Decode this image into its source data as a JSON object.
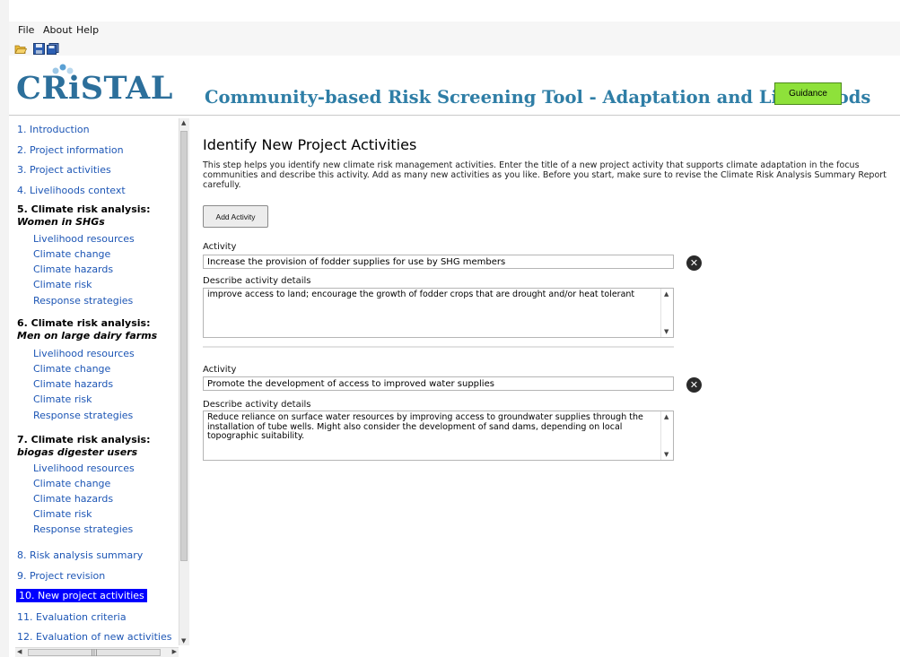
{
  "menu": [
    "File",
    "About",
    "Help"
  ],
  "toolbar": {
    "icons": [
      "folder-open-icon",
      "save-icon",
      "save-all-icon"
    ]
  },
  "logo": {
    "text": "CRiSTAL"
  },
  "header": {
    "title": "Community-based Risk Screening Tool - Adaptation and Livelihoods",
    "guidance_label": "Guidance"
  },
  "sidebar": {
    "items": [
      {
        "label": "1. Introduction"
      },
      {
        "label": "2. Project information"
      },
      {
        "label": "3. Project activities"
      },
      {
        "label": "4. Livelihoods context"
      }
    ],
    "groups": [
      {
        "title": "5. Climate risk analysis:",
        "subtitle": "Women in SHGs",
        "sub": [
          "Livelihood resources",
          "Climate change",
          "Climate hazards",
          "Climate risk",
          "Response strategies"
        ]
      },
      {
        "title": "6. Climate risk analysis:",
        "subtitle": "Men on large dairy farms",
        "sub": [
          "Livelihood resources",
          "Climate change",
          "Climate hazards",
          "Climate risk",
          "Response strategies"
        ]
      },
      {
        "title": "7. Climate risk analysis:",
        "subtitle": "biogas digester users",
        "sub": [
          "Livelihood resources",
          "Climate change",
          "Climate hazards",
          "Climate risk",
          "Response strategies"
        ]
      }
    ],
    "bottom_items": [
      {
        "label": "8. Risk analysis summary"
      },
      {
        "label": "9. Project revision"
      },
      {
        "label": "10. New project activities"
      },
      {
        "label": "11. Evaluation criteria"
      },
      {
        "label": "12. Evaluation of new activities"
      }
    ]
  },
  "main": {
    "title": "Identify New Project Activities",
    "description": "This step helps you identify new climate risk management activities. Enter the title of a new project activity that supports climate adaptation in the focus communities and describe this activity. Add as many new activities as you like. Before you start, make sure to revise the Climate Risk Analysis Summary Report carefully.",
    "add_button": "Add Activity",
    "activity_label": "Activity",
    "details_label": "Describe activity details",
    "activities": [
      {
        "title": "Increase the provision of fodder supplies for use by SHG members",
        "details": "improve access to land; encourage the growth of fodder crops that are drought and/or heat tolerant"
      },
      {
        "title": "Promote the development of access to improved water supplies",
        "details": "Reduce reliance on surface water resources by improving access to groundwater supplies through the installation of tube wells. Might also consider the development of sand dams, depending on local topographic suitability."
      }
    ]
  }
}
